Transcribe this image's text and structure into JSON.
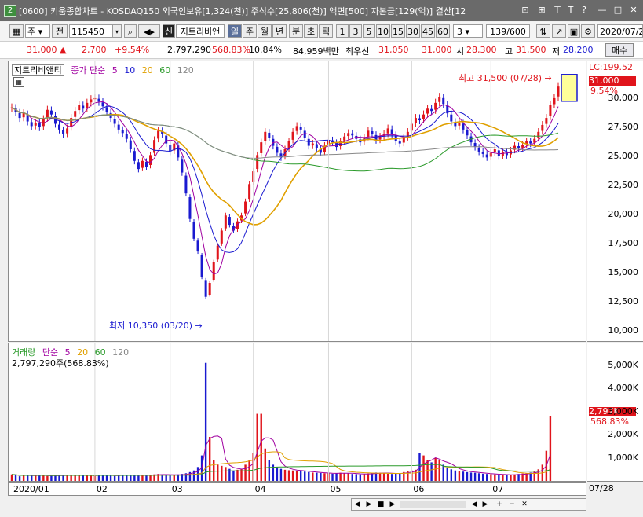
{
  "window": {
    "title": "[0600] 키움종합차트 - KOSDAQ150 외국인보유[1,324(천)] 주식수[25,806(천)] 액면[500] 자본금[129(억)] 결산[12",
    "app_number": "2",
    "buttons": [
      "⊡",
      "⊞",
      "⊤",
      "T",
      "?",
      "—",
      "□",
      "✕"
    ]
  },
  "toolbar": {
    "market": "주",
    "mode": "전",
    "code": "115450",
    "indicator_badge": "신",
    "stock_name": "지트리비앤",
    "periods": [
      "일",
      "주",
      "월",
      "년",
      "분",
      "초",
      "틱"
    ],
    "selected_period": "일",
    "numbers": [
      "1",
      "3",
      "5",
      "10",
      "15",
      "30",
      "45",
      "60"
    ],
    "count_value": "3",
    "page": "139/600",
    "date": "2020/07/2"
  },
  "quote": {
    "price": "31,000",
    "change": "2,700",
    "change_pct": "+9.54%",
    "volume": "2,797,290",
    "vol_ratio": "568.83%",
    "turnover": "10.84%",
    "amount": "84,959백만",
    "best_label": "최우선",
    "ask": "31,050",
    "bid": "31,000",
    "open_label": "시",
    "open": "28,300",
    "high_label": "고",
    "high": "31,500",
    "low_label": "저",
    "low": "28,200",
    "buy_label": "매수"
  },
  "price_panel": {
    "stock_tab": "지트리비앤티",
    "legend": [
      "종가 단순",
      "5",
      "10",
      "20",
      "60",
      "120"
    ],
    "legend_colors": [
      "#a000a0",
      "#a000a0",
      "#1a1ad0",
      "#e0a000",
      "#2a9a2a",
      "#888888"
    ],
    "lc_label": "LC:199.52",
    "price_tag": "31,000",
    "pct_tag": "9.54%",
    "high_note": "최고 31,500 (07/28)",
    "low_note": "최저 10,350 (03/20)",
    "ticks": [
      "30,000",
      "27,500",
      "25,000",
      "22,500",
      "20,000",
      "17,500",
      "15,000",
      "12,500",
      "10,000"
    ]
  },
  "volume_panel": {
    "legend": [
      "거래량",
      "단순",
      "5",
      "20",
      "60",
      "120"
    ],
    "legend_colors": [
      "#2a9a2a",
      "#a000a0",
      "#a000a0",
      "#e0a000",
      "#2a9a2a",
      "#888888"
    ],
    "current": "2,797,290주(568.83%)",
    "vol_tag": "2,797K",
    "pct_tag": "568.83%",
    "ticks": [
      "5,000K",
      "4,000K",
      "3,000K",
      "2,000K",
      "1,000K"
    ]
  },
  "xaxis": {
    "labels": [
      "2020/01",
      "02",
      "03",
      "04",
      "05",
      "06",
      "07"
    ],
    "right_label": "07/28"
  },
  "scroll_buttons": [
    "◀",
    "▶",
    "■",
    "▶",
    "◀",
    "▶",
    "+",
    "−",
    "✕"
  ],
  "chart_data": {
    "type": "candlestick",
    "symbol": "115450",
    "name": "지트리비앤티",
    "period": "daily",
    "x_range": [
      "2020/01",
      "07/28"
    ],
    "ylim": [
      9500,
      32500
    ],
    "closes": [
      29200,
      28800,
      28300,
      28700,
      28000,
      27600,
      27900,
      27500,
      28200,
      29000,
      28600,
      27800,
      27300,
      26900,
      27400,
      28300,
      28900,
      29400,
      29100,
      29600,
      29900,
      30000,
      29700,
      29300,
      28800,
      28300,
      27800,
      27300,
      27000,
      26500,
      25600,
      24600,
      23900,
      24600,
      24100,
      25100,
      26400,
      27200,
      26900,
      26100,
      25400,
      26100,
      24900,
      23600,
      21800,
      19600,
      17900,
      16800,
      14600,
      12900,
      14100,
      15900,
      17300,
      18600,
      19900,
      19100,
      18600,
      19400,
      19900,
      21100,
      22600,
      23700,
      25100,
      26200,
      27100,
      26600,
      25900,
      25300,
      24900,
      25600,
      26300,
      27100,
      27600,
      27300,
      26600,
      25900,
      26100,
      25700,
      25300,
      25900,
      26400,
      26200,
      25800,
      26300,
      26700,
      27000,
      26800,
      26500,
      26200,
      26600,
      27200,
      26900,
      26400,
      26700,
      26900,
      27400,
      26900,
      26300,
      26100,
      26600,
      27100,
      27800,
      28300,
      28100,
      28600,
      29100,
      28900,
      29600,
      30100,
      29500,
      28700,
      28000,
      27600,
      27900,
      27300,
      26800,
      26200,
      25800,
      25400,
      25200,
      24900,
      25300,
      25600,
      25000,
      25400,
      25100,
      25500,
      25900,
      25700,
      26000,
      26300,
      26100,
      26500,
      27100,
      27700,
      28300,
      29400,
      30000,
      31000
    ],
    "high_point": {
      "value": 31500,
      "date": "07/28"
    },
    "low_point": {
      "value": 10350,
      "date": "03/20"
    },
    "last": {
      "close": 31000,
      "change": 2700,
      "pct": 9.54
    },
    "ma_periods": [
      5,
      10,
      20,
      60,
      120
    ],
    "volume": {
      "unit": "K",
      "ylim": [
        0,
        5600
      ],
      "values": [
        280,
        240,
        200,
        230,
        250,
        220,
        260,
        240,
        230,
        210,
        220,
        240,
        260,
        230,
        240,
        250,
        260,
        230,
        240,
        220,
        230,
        250,
        260,
        240,
        230,
        220,
        210,
        250,
        270,
        260,
        240,
        230,
        260,
        250,
        240,
        260,
        280,
        300,
        270,
        250,
        240,
        260,
        280,
        300,
        330,
        380,
        450,
        600,
        1100,
        5100,
        1900,
        900,
        700,
        650,
        600,
        520,
        450,
        480,
        500,
        700,
        900,
        1200,
        2900,
        2900,
        1400,
        900,
        700,
        600,
        520,
        480,
        460,
        450,
        430,
        420,
        400,
        380,
        360,
        350,
        340,
        330,
        320,
        310,
        330,
        350,
        340,
        320,
        300,
        290,
        280,
        300,
        320,
        340,
        360,
        350,
        330,
        310,
        300,
        320,
        340,
        380,
        420,
        450,
        480,
        1200,
        1100,
        900,
        800,
        1000,
        900,
        700,
        600,
        500,
        450,
        420,
        400,
        380,
        360,
        350,
        330,
        310,
        300,
        290,
        280,
        270,
        260,
        250,
        260,
        280,
        300,
        320,
        340,
        360,
        400,
        500,
        700,
        1300,
        2797
      ]
    }
  }
}
